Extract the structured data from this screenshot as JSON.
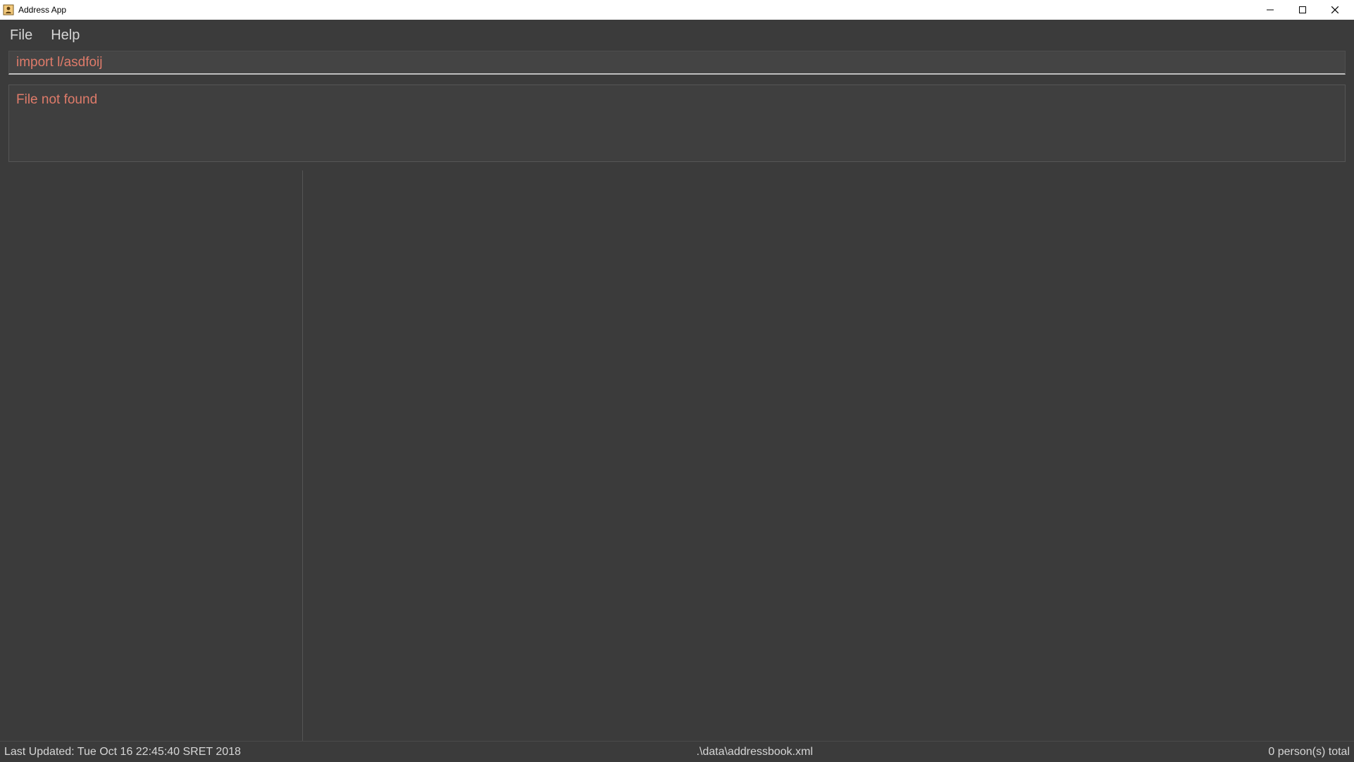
{
  "window": {
    "title": "Address App"
  },
  "menu": {
    "file": "File",
    "help": "Help"
  },
  "command": {
    "value": "import l/asdfoij"
  },
  "message": {
    "text": "File not found"
  },
  "status": {
    "last_updated": "Last Updated: Tue Oct 16 22:45:40 SRET 2018",
    "file_path": ".\\data\\addressbook.xml",
    "count_text": "0 person(s) total"
  },
  "colors": {
    "error_text": "#df7b6a",
    "bg": "#3b3b3b",
    "panel": "#444444"
  }
}
